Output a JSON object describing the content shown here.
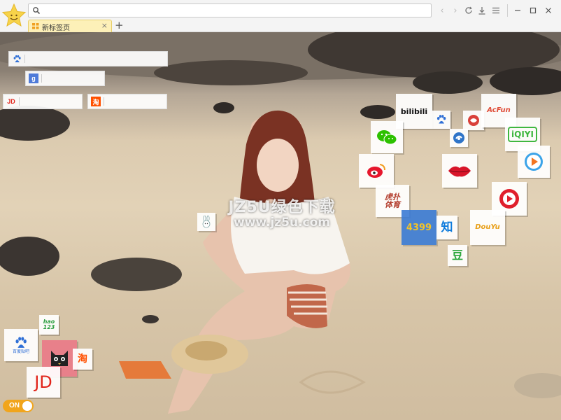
{
  "browser": {
    "address_placeholder": "",
    "tab": {
      "title": "新标签页"
    },
    "new_tab_symbol": "+",
    "icons": [
      "back-icon",
      "forward-icon",
      "refresh-icon",
      "download-icon",
      "menu-icon",
      "minimize-icon",
      "maximize-icon",
      "close-icon"
    ]
  },
  "search_boxes": [
    {
      "engine": "baidu",
      "icon": "baidu-paw-icon",
      "value": ""
    },
    {
      "engine": "google",
      "icon": "google-icon",
      "icon_text": "g",
      "value": ""
    },
    {
      "engine": "jd",
      "icon": "jd-icon",
      "icon_text": "JD",
      "value": ""
    },
    {
      "engine": "taobao",
      "icon": "taobao-icon",
      "icon_text": "淘",
      "value": ""
    }
  ],
  "wallpaper": {
    "watermark_line1": "JZ5U绿色下载",
    "watermark_line2": "www.jz5u.com"
  },
  "tiles_right": [
    {
      "name": "bilibili",
      "text": "bilibili"
    },
    {
      "name": "baidu",
      "icon": "baidu-paw-icon"
    },
    {
      "name": "phoenix",
      "icon": "phoenix-icon"
    },
    {
      "name": "acfun",
      "text": "AcFun"
    },
    {
      "name": "wechat",
      "icon": "wechat-icon"
    },
    {
      "name": "360-browser",
      "icon": "browser-swirl-icon"
    },
    {
      "name": "iqiyi",
      "text": "iQIYI"
    },
    {
      "name": "weibo",
      "icon": "weibo-icon"
    },
    {
      "name": "lips",
      "icon": "lips-icon"
    },
    {
      "name": "tencent-video",
      "icon": "play-icon"
    },
    {
      "name": "huya",
      "text": "虎扑\n体育"
    },
    {
      "name": "youku-video",
      "icon": "video-play-icon"
    },
    {
      "name": "4399",
      "text": "4399"
    },
    {
      "name": "zhihu",
      "text": "知"
    },
    {
      "name": "douyu",
      "text": "DouYu"
    },
    {
      "name": "douban",
      "text": "豆"
    }
  ],
  "tiles_left": [
    {
      "name": "hao123",
      "text": "hao\n123"
    },
    {
      "name": "baidu-tieba",
      "text": "百度贴吧"
    },
    {
      "name": "tmall",
      "icon": "tmall-cat-icon"
    },
    {
      "name": "taobao",
      "text": "淘"
    },
    {
      "name": "jd",
      "text": "JD"
    },
    {
      "name": "small-bunny",
      "icon": "bunny-icon"
    }
  ],
  "toggle": {
    "label": "ON",
    "state": "on"
  },
  "colors": {
    "tab_bg": "#fdf0b8",
    "toggle": "#f1a51c",
    "bilibili": "#111111",
    "acfun": "#e04f3a",
    "iqiyi": "#3fb73f",
    "wechat": "#2dc100",
    "weibo": "#e6162d",
    "tile_4399": "#3a7bd5",
    "zhihu": "#0e7bdc",
    "douban": "#2aa53b",
    "jd": "#e1251b",
    "taobao": "#ff5000"
  }
}
